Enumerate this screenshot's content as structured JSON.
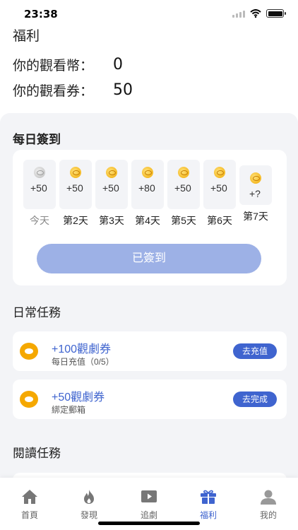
{
  "status": {
    "time": "23:38"
  },
  "header": {
    "title": "福利"
  },
  "balances": [
    {
      "label": "你的觀看幣：",
      "value": "0"
    },
    {
      "label": "你的觀看券：",
      "value": "50"
    }
  ],
  "checkin": {
    "title": "每日簽到",
    "days": [
      {
        "amount": "+50",
        "label": "今天",
        "today": true
      },
      {
        "amount": "+50",
        "label": "第2天"
      },
      {
        "amount": "+50",
        "label": "第3天"
      },
      {
        "amount": "+80",
        "label": "第4天"
      },
      {
        "amount": "+50",
        "label": "第5天"
      },
      {
        "amount": "+50",
        "label": "第6天"
      },
      {
        "amount": "+?",
        "label": "第7天"
      }
    ],
    "button_label": "已簽到"
  },
  "daily_tasks": {
    "title": "日常任務",
    "items": [
      {
        "reward": "+100觀劇券",
        "desc": "每日充值（0/5）",
        "button": "去充值"
      },
      {
        "reward": "+50觀劇券",
        "desc": "綁定郵箱",
        "button": "去完成"
      }
    ]
  },
  "reading_tasks": {
    "title": "閱讀任務"
  },
  "tabs": [
    {
      "label": "首頁",
      "icon": "home-icon"
    },
    {
      "label": "發現",
      "icon": "fire-icon"
    },
    {
      "label": "追劇",
      "icon": "play-icon"
    },
    {
      "label": "福利",
      "icon": "gift-icon",
      "active": true
    },
    {
      "label": "我的",
      "icon": "profile-icon"
    }
  ],
  "colors": {
    "accent": "#3f64cf",
    "signed_button": "#9db1e6",
    "panel_bg": "#f3f4f7",
    "coin": "#f5a800"
  }
}
